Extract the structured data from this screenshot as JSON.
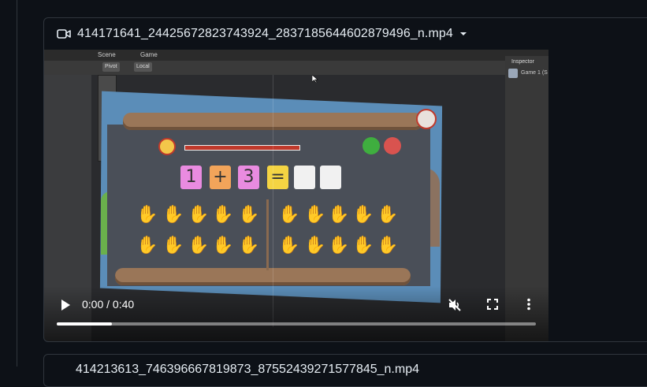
{
  "attachment": {
    "file_name": "414171641_24425672823743924_2837185644602879496_n.mp4",
    "icons": {
      "type": "video-camera-icon",
      "menu": "caret-down-icon"
    }
  },
  "editor": {
    "tabs": [
      "Scene",
      "Game"
    ],
    "pivot_label": "Pivot",
    "local_label": "Local",
    "inspector_label": "Inspector",
    "inspector_item": "Game 1 (S"
  },
  "game": {
    "equation": [
      "1",
      "+",
      "3",
      "=",
      "",
      ""
    ],
    "tile_colors": [
      "#e98be0",
      "#f2a45a",
      "#e98be0",
      "#f4d443",
      "#f1f1f1",
      "#f1f1f1"
    ],
    "progress_bar_color": "#c0392b"
  },
  "player": {
    "time": "0:00 / 0:40",
    "progress": 0.115,
    "muted": true,
    "icons": [
      "play-icon",
      "muted-volume-icon",
      "fullscreen-icon",
      "more-options-icon"
    ]
  },
  "next_attachment": {
    "file_name": "414213613_746396667819873_87552439271577845_n.mp4"
  }
}
